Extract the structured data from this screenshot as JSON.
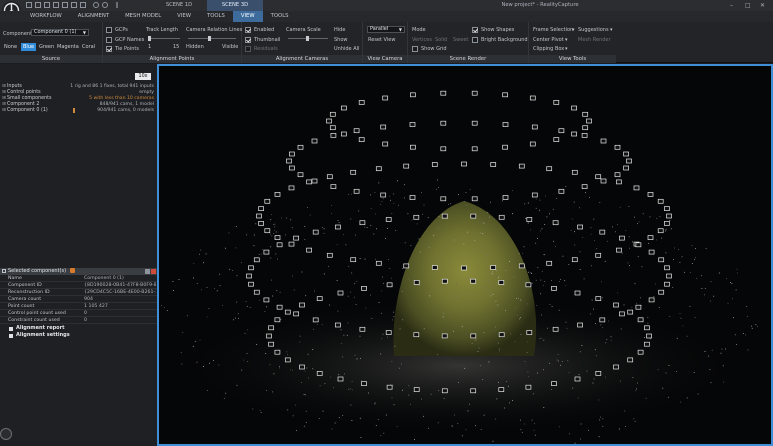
{
  "quick_access_count": 9,
  "scene_tabs": [
    "SCENE 1D",
    "SCENE 3D"
  ],
  "window_title": "New project* - RealityCapture",
  "menu": [
    "WORKFLOW",
    "ALIGNMENT",
    "MESH MODEL",
    "VIEW",
    "TOOLS",
    "VIEW",
    "TOOLS"
  ],
  "active_menu_index": 5,
  "ribbon": {
    "source": {
      "component_label": "Component",
      "component_value": "Component 0 (1)",
      "color_buttons": [
        "None",
        "Blue",
        "Green",
        "Magenta",
        "Coral"
      ],
      "active_color_index": 1,
      "label": "Source"
    },
    "alignment_points": {
      "gcps": "GCPs",
      "gcp_names": "GCP Names",
      "tie_points": "Tie Points",
      "track_length": "Track Length",
      "track_min": "1",
      "track_max": "15",
      "camera_relation": "Camera Relation Lines",
      "hidden": "Hidden",
      "visible": "Visible",
      "label": "Alignment Points"
    },
    "alignment_cameras": {
      "enabled": "Enabled",
      "thumbnail": "Thumbnail",
      "residuals": "Residuals",
      "camera_scale": "Camera Scale",
      "hide": "Hide",
      "show": "Show",
      "unhide_all": "Unhide All",
      "label": "Alignment Cameras"
    },
    "view_camera": {
      "projection": "Parallel",
      "reset_view": "Reset View",
      "label": "View Camera"
    },
    "scene_render": {
      "mode": "Mode",
      "vertices": "Vertices",
      "solid": "Solid",
      "sweet": "Sweet",
      "show_grid": "Show Grid",
      "show_shapes": "Show Shapes",
      "bright_background": "Bright Background",
      "label": "Scene Render"
    },
    "view_tools": {
      "frame_selection": "Frame Selection",
      "suggestions": "Suggestions",
      "center_pivot": "Center Pivot",
      "mesh_render": "Mesh Render",
      "clipping_box": "Clipping Box",
      "label": "View Tools"
    }
  },
  "tree": {
    "button": "10x",
    "rows": [
      {
        "name": "Inputs",
        "value": "1 rig and 86 1 fixes, total 941 inputs",
        "warn": false
      },
      {
        "name": "Control points",
        "value": "empty",
        "warn": false
      },
      {
        "name": "Small components",
        "value": "5 with less than 10 cameras",
        "warn": true
      },
      {
        "name": "Component 2",
        "value": "848/941 cams, 1 model",
        "warn": false
      },
      {
        "name": "Component 0 (1)",
        "value": "904/941 cams, 0 models",
        "warn": false
      }
    ]
  },
  "selected": {
    "header": "Selected component(s)",
    "props": [
      {
        "k": "Name",
        "v": "Component 0 (1)"
      },
      {
        "k": "Component ID",
        "v": "{8D190028-0B41-47F8-B0F9-8T..."
      },
      {
        "k": "Reconstruction ID",
        "v": "{29CD4C5C-16BE-4E00-B261-1C..."
      },
      {
        "k": "Camera count",
        "v": "904"
      },
      {
        "k": "Point count",
        "v": "1 105 427"
      },
      {
        "k": "Control point count used",
        "v": "0"
      },
      {
        "k": "Constraint count used",
        "v": "0"
      }
    ],
    "sections": [
      "Alignment report",
      "Alignment settings"
    ]
  }
}
